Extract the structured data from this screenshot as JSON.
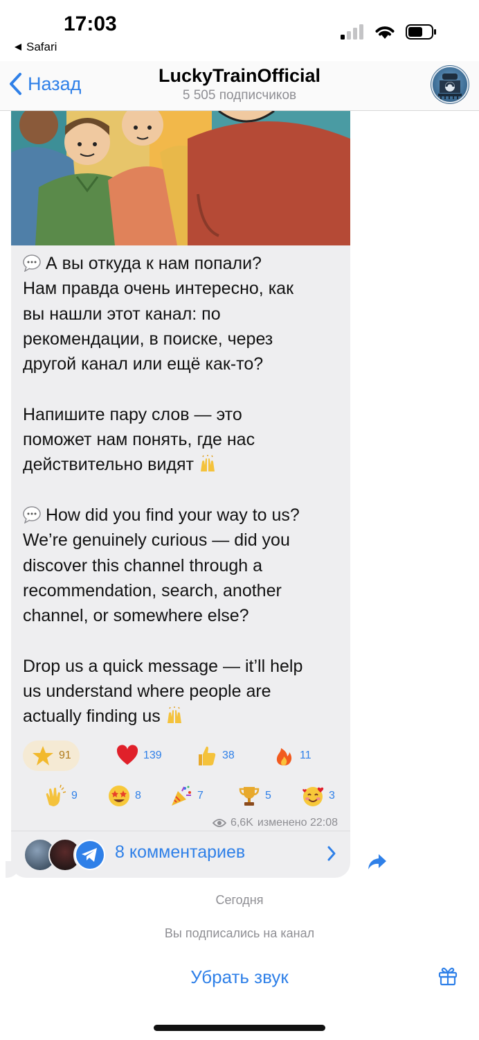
{
  "status": {
    "time": "17:03",
    "back_app": "Safari"
  },
  "nav": {
    "back_label": "Назад",
    "title": "LuckyTrainOfficial",
    "subtitle": "5 505 подписчиков"
  },
  "message": {
    "lines_ru": [
      "А вы откуда к нам попали?",
      "Нам правда очень интересно, как",
      "вы нашли этот канал: по",
      "рекомендации, в поиске, через",
      "другой канал или ещё как-то?",
      "",
      "Напишите пару слов — это",
      "поможет нам понять, где нас",
      "действительно видят"
    ],
    "lines_en": [
      "How did you find your way to us?",
      "We’re genuinely curious — did you",
      "discover this channel through a",
      "recommendation, search, another",
      "channel, or somewhere else?",
      "",
      "Drop us a quick message — it’ll help",
      "us understand where people are",
      "actually finding us"
    ]
  },
  "reactions": [
    {
      "icon": "star-icon",
      "count": "91",
      "active": true
    },
    {
      "icon": "heart-icon",
      "count": "139"
    },
    {
      "icon": "thumbs-up-icon",
      "count": "38"
    },
    {
      "icon": "fire-icon",
      "count": "11"
    },
    {
      "icon": "clap-icon",
      "count": "9"
    },
    {
      "icon": "star-struck-icon",
      "count": "8"
    },
    {
      "icon": "party-popper-icon",
      "count": "7"
    },
    {
      "icon": "trophy-icon",
      "count": "5"
    },
    {
      "icon": "smiling-hearts-icon",
      "count": "3"
    }
  ],
  "meta": {
    "views": "6,6K",
    "edited": "изменено 22:08"
  },
  "comments": {
    "label": "8 комментариев"
  },
  "separators": {
    "date": "Сегодня",
    "subscribed": "Вы подписались на канал"
  },
  "bottom": {
    "mute_label": "Убрать звук"
  },
  "colors": {
    "accent": "#2f80e8",
    "bubble": "#eeeef0",
    "muted": "#8e8e93"
  }
}
